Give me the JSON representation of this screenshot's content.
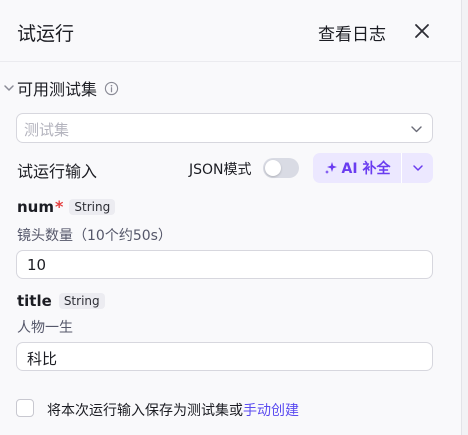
{
  "header": {
    "title": "试运行",
    "view_logs": "查看日志"
  },
  "test_set": {
    "section_label": "可用测试集",
    "select_placeholder": "测试集"
  },
  "run_input": {
    "label": "试运行输入",
    "json_mode_label": "JSON模式",
    "json_mode_on": false,
    "ai_button_label": "AI 补全"
  },
  "fields": [
    {
      "name": "num",
      "required_mark": "*",
      "type": "String",
      "description": "镜头数量（10个约50s）",
      "value": "10"
    },
    {
      "name": "title",
      "required_mark": "",
      "type": "String",
      "description": "人物一生",
      "value": "科比"
    }
  ],
  "footer": {
    "save_text": "将本次运行输入保存为测试集或",
    "manual_create_link": "手动创建",
    "checked": false
  },
  "colors": {
    "accent": "#6a3cf0",
    "link": "#5b4cf0",
    "ai_button_bg": "#ece8ff",
    "required": "#e53e3e"
  },
  "icons": {
    "close": "close-icon",
    "collapse": "chevron-down-icon",
    "info": "info-icon",
    "select_arrow": "chevron-down-icon",
    "ai": "sparkle-icon"
  }
}
